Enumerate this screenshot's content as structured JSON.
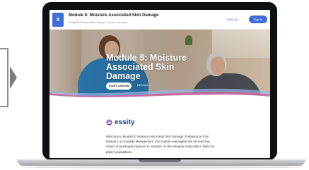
{
  "header": {
    "badge": "8",
    "title": "Module 8: Moisture Associated Skin Damage",
    "breadcrumb": "Essity/Ed-Future/Skin Group  ›  Current Version  ›",
    "link": "VIEW ALL",
    "signin_label": "Sign in"
  },
  "hero": {
    "title": "Module 8: Moisture Associated Skin Damage",
    "start_label": "START LESSON",
    "details_label": "DETAILS  →"
  },
  "content": {
    "brand": "essity",
    "intro": "Welcome to Module 8: Moisture Associated Skin Damage. Following on from Module 4 on Exudate Management, this module investigates the far-reaching impact of prolonged exposure to moisture on skin integrity, especially in high-risk patient populations."
  },
  "colors": {
    "accent": "#3e6fd8",
    "brand": "#1e3c8c",
    "swoosh_pink": "#d85c96",
    "swoosh_blue": "#9bb8e6"
  }
}
